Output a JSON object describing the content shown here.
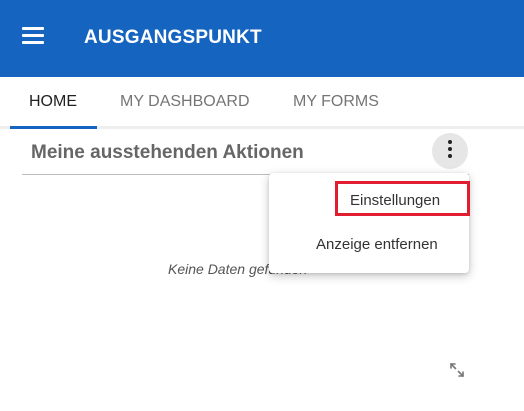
{
  "header": {
    "title": "AUSGANGSPUNKT",
    "menu_icon": "hamburger-icon",
    "background": "#1565c0"
  },
  "tabs": [
    {
      "label": "HOME",
      "active": true
    },
    {
      "label": "MY DASHBOARD",
      "active": false
    },
    {
      "label": "MY FORMS",
      "active": false
    }
  ],
  "widget": {
    "title": "Meine ausstehenden Aktionen",
    "empty_message": "Keine Daten gefunden",
    "more_icon": "more-vertical-icon",
    "expand_icon": "expand-icon"
  },
  "context_menu": {
    "items": [
      {
        "label": "Einstellungen",
        "highlighted": true
      },
      {
        "label": "Anzeige entfernen",
        "highlighted": false
      }
    ],
    "highlight_color": "#e01e2f"
  }
}
